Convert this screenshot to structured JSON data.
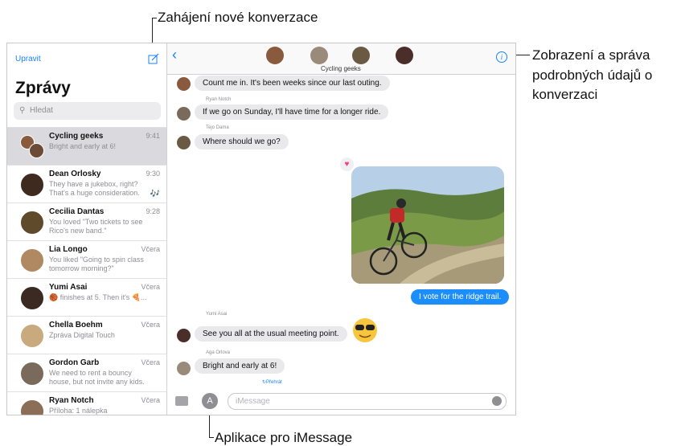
{
  "callouts": {
    "new_conversation": "Zahájení nové konverzace",
    "details_line1": "Zobrazení a správa",
    "details_line2": "podrobných údajů o",
    "details_line3": "konverzaci",
    "imessage_apps": "Aplikace pro iMessage"
  },
  "sidebar": {
    "edit_label": "Upravit",
    "title": "Zprávy",
    "search_placeholder": "Hledat",
    "conversations": [
      {
        "name": "Cycling geeks",
        "time": "9:41",
        "preview": "Bright and early at 6!",
        "selected": true
      },
      {
        "name": "Dean Orlosky",
        "time": "9:30",
        "preview": "They have a jukebox, right? That's a huge consideration.",
        "badge": "🎶"
      },
      {
        "name": "Cecilia Dantas",
        "time": "9:28",
        "preview": "You loved \"Two tickets to see Rico's new band.\""
      },
      {
        "name": "Lia Longo",
        "time": "Včera",
        "preview": "You liked \"Going to spin class tomorrow morning?\""
      },
      {
        "name": "Yumi Asai",
        "time": "Včera",
        "preview": "🏀 finishes at 5. Then it's 🍕..."
      },
      {
        "name": "Chella Boehm",
        "time": "Včera",
        "preview": "Zpráva Digital Touch"
      },
      {
        "name": "Gordon Garb",
        "time": "Včera",
        "preview": "We need to rent a bouncy house, but not invite any kids."
      },
      {
        "name": "Ryan Notch",
        "time": "Včera",
        "preview": "Příloha: 1 nálepka"
      }
    ]
  },
  "chat": {
    "group_name": "Cycling geeks",
    "input_placeholder": "iMessage",
    "replay_label": "↻Přehrát",
    "messages": [
      {
        "sender": "",
        "text": "Count me in. It's been weeks since our last outing."
      },
      {
        "sender": "Ryan Notch",
        "text": "If we go on Sunday, I'll have time for a longer ride."
      },
      {
        "sender": "Tejo Dama",
        "text": "Where should we go?"
      },
      {
        "sender": "",
        "text": "I vote for the ridge trail.",
        "outgoing": true
      },
      {
        "sender": "Yumi Asai",
        "text": "See you all at the usual meeting point."
      },
      {
        "sender": "Aga Orlova",
        "text": "Bright and early at 6!"
      }
    ]
  },
  "colors": {
    "accent": "#1b8efb",
    "bubble_in": "#e9e9eb",
    "selected_row": "#d9d9de"
  }
}
